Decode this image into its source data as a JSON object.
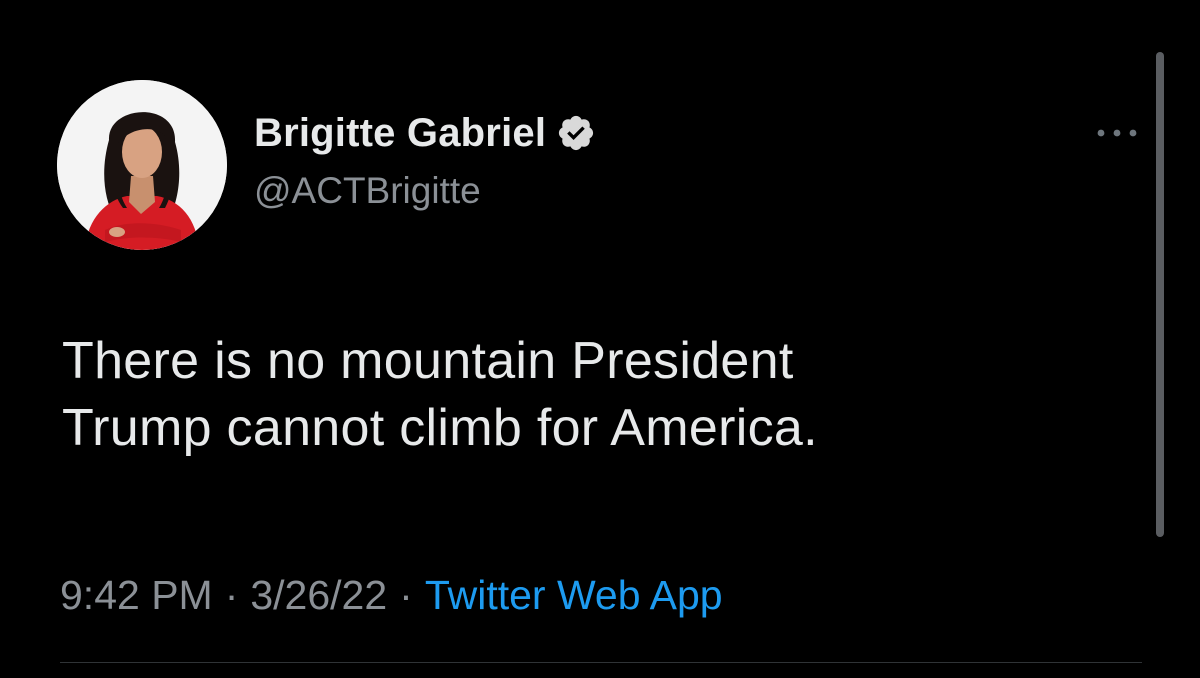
{
  "tweet": {
    "author": {
      "display_name": "Brigitte Gabriel",
      "handle": "@ACTBrigitte",
      "verified": true
    },
    "text_line_1": "There is no mountain President",
    "text_line_2": "Trump cannot climb for America.",
    "time": "9:42 PM",
    "separator": "·",
    "date": "3/26/22",
    "source": "Twitter Web App"
  },
  "icons": {
    "verified": "verified-badge-icon",
    "more": "more-horizontal-icon"
  },
  "colors": {
    "background": "#000000",
    "primary_text": "#e7e9ea",
    "secondary_text": "#8b9096",
    "link": "#1d9bf0",
    "divider": "#2f3336"
  }
}
